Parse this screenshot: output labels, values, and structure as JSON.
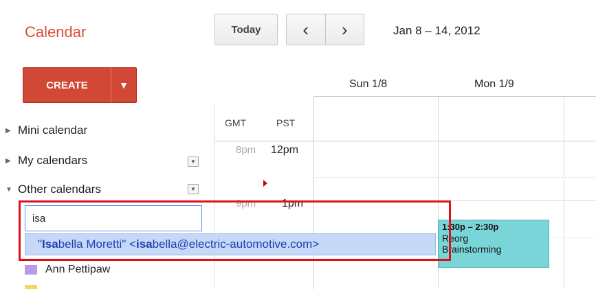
{
  "header": {
    "app_title": "Calendar",
    "today_label": "Today",
    "prev_label": "‹",
    "next_label": "›",
    "date_range": "Jan 8 – 14, 2012"
  },
  "create": {
    "label": "CREATE",
    "dropdown_symbol": "▼"
  },
  "sidebar": {
    "mini_calendar": "Mini calendar",
    "my_calendars": "My calendars",
    "other_calendars": "Other calendars",
    "search_value": "isa",
    "suggestion": {
      "quote_open": "\"",
      "name_match": "Isa",
      "name_rest": "bella Moretti\" <",
      "email_match": "isa",
      "email_rest": "bella@electric-automotive.com>"
    },
    "other_calendar_items": [
      {
        "label": "Ann Pettipaw",
        "color": "#b99ae8"
      }
    ]
  },
  "grid": {
    "days": [
      "Sun 1/8",
      "Mon 1/9"
    ],
    "timezones": [
      "GMT",
      "PST"
    ],
    "times_gmt": [
      "8pm",
      "9pm"
    ],
    "times_pst": [
      "12pm",
      "1pm"
    ]
  },
  "event": {
    "time": "1:30p – 2:30p",
    "title_line1": "Reorg",
    "title_line2": "Brainstorming",
    "color": "#7ad5d8"
  },
  "colors": {
    "brand": "#dd4b39",
    "create_button": "#d14836",
    "highlight": "#e10f1a",
    "suggestion_bg": "#c6d8f7"
  }
}
